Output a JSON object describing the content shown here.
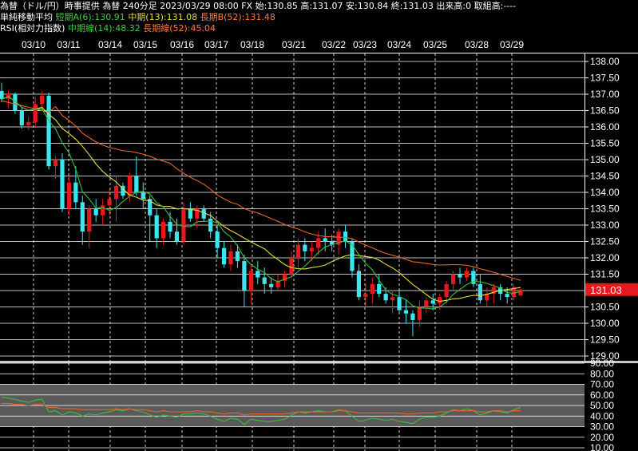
{
  "header": {
    "line1": "為替（ドル/円）時事提供 為替 240分足 2023/03/29 08:00 FX 始:130.85 高:131.07 安:130.84 終:131.03 出来高:0 取組高:----",
    "ma_title": "単純移動平均",
    "ma_short": "短期A(6):130.91",
    "ma_mid": "中期(13):131.08",
    "ma_long": "長期B(52):131.48",
    "rsi_title": "RSI(相対力指数)",
    "rsi_mid": "中期線(14):48.32",
    "rsi_long": "長期線(52):45.04"
  },
  "colors": {
    "up": "#e8191e",
    "down": "#3ce6f0",
    "ma_short": "#3cbe3c",
    "ma_mid": "#e6dc3c",
    "ma_long": "#e8642d",
    "rsi_mid": "#3cbe3c",
    "rsi_long": "#e8642d",
    "price_box": "#e8191e"
  },
  "chart_data": [
    {
      "type": "candlestick",
      "dates": [
        "03/10",
        "03/11",
        "03/14",
        "03/15",
        "03/16",
        "03/17",
        "03/18",
        "03/21",
        "03/22",
        "03/23",
        "03/24",
        "03/25",
        "03/28",
        "03/29"
      ],
      "ylim": [
        129.0,
        138.0
      ],
      "yticks": [
        "138.00",
        "137.50",
        "137.00",
        "136.50",
        "136.00",
        "135.50",
        "135.00",
        "134.50",
        "134.00",
        "133.50",
        "133.00",
        "132.50",
        "132.00",
        "131.50",
        "131.00",
        "130.50",
        "130.00",
        "129.50",
        "129.00"
      ],
      "last_price": "131.03",
      "ohlc": [
        [
          137.1,
          137.35,
          136.75,
          136.85
        ],
        [
          136.85,
          137.1,
          136.55,
          137.0
        ],
        [
          137.0,
          137.05,
          136.4,
          136.5
        ],
        [
          136.5,
          136.6,
          135.95,
          136.05
        ],
        [
          136.05,
          136.3,
          135.9,
          136.15
        ],
        [
          136.15,
          136.9,
          136.0,
          136.7
        ],
        [
          136.7,
          137.1,
          136.5,
          136.95
        ],
        [
          136.95,
          137.05,
          134.7,
          134.8
        ],
        [
          134.8,
          135.1,
          134.4,
          135.0
        ],
        [
          135.0,
          135.2,
          133.4,
          133.5
        ],
        [
          133.5,
          134.5,
          133.3,
          134.3
        ],
        [
          134.3,
          134.8,
          133.5,
          133.7
        ],
        [
          133.7,
          133.9,
          132.4,
          132.8
        ],
        [
          132.8,
          133.6,
          132.3,
          133.5
        ],
        [
          133.5,
          133.8,
          133.1,
          133.3
        ],
        [
          133.3,
          133.8,
          133.0,
          133.6
        ],
        [
          133.6,
          134.1,
          133.3,
          133.8
        ],
        [
          133.8,
          134.5,
          133.1,
          134.2
        ],
        [
          134.2,
          134.3,
          133.8,
          133.9
        ],
        [
          133.9,
          134.6,
          133.7,
          134.5
        ],
        [
          134.5,
          135.1,
          133.9,
          134.0
        ],
        [
          134.0,
          134.3,
          133.5,
          133.8
        ],
        [
          133.8,
          133.9,
          132.5,
          133.3
        ],
        [
          133.3,
          133.5,
          132.3,
          132.6
        ],
        [
          132.6,
          133.2,
          132.4,
          133.1
        ],
        [
          133.1,
          133.4,
          132.6,
          132.8
        ],
        [
          132.8,
          133.2,
          132.4,
          132.5
        ],
        [
          132.5,
          133.7,
          132.4,
          133.5
        ],
        [
          133.5,
          133.7,
          133.1,
          133.2
        ],
        [
          133.2,
          133.6,
          132.9,
          133.5
        ],
        [
          133.5,
          133.6,
          133.1,
          133.2
        ],
        [
          133.2,
          133.4,
          132.6,
          132.8
        ],
        [
          132.8,
          133.0,
          132.0,
          132.3
        ],
        [
          132.3,
          132.5,
          131.7,
          131.8
        ],
        [
          131.8,
          132.4,
          131.6,
          132.2
        ],
        [
          132.2,
          132.4,
          131.7,
          131.9
        ],
        [
          131.9,
          132.1,
          130.5,
          131.0
        ],
        [
          131.0,
          131.8,
          130.6,
          131.6
        ],
        [
          131.6,
          131.9,
          131.2,
          131.4
        ],
        [
          131.4,
          131.7,
          130.9,
          131.2
        ],
        [
          131.2,
          131.4,
          130.9,
          131.1
        ],
        [
          131.1,
          131.5,
          131.0,
          131.3
        ],
        [
          131.3,
          131.6,
          131.1,
          131.5
        ],
        [
          131.5,
          132.2,
          131.4,
          132.0
        ],
        [
          132.0,
          132.6,
          131.7,
          132.4
        ],
        [
          132.4,
          132.6,
          131.9,
          132.2
        ],
        [
          132.2,
          132.5,
          131.9,
          132.3
        ],
        [
          132.3,
          132.8,
          132.1,
          132.6
        ],
        [
          132.6,
          132.9,
          132.2,
          132.5
        ],
        [
          132.5,
          132.7,
          132.2,
          132.4
        ],
        [
          132.4,
          132.9,
          132.1,
          132.8
        ],
        [
          132.8,
          133.0,
          132.3,
          132.5
        ],
        [
          132.5,
          132.6,
          131.4,
          131.6
        ],
        [
          131.6,
          131.8,
          130.7,
          130.8
        ],
        [
          130.8,
          131.2,
          130.5,
          130.9
        ],
        [
          130.9,
          131.4,
          130.6,
          131.2
        ],
        [
          131.2,
          131.5,
          130.8,
          130.9
        ],
        [
          130.9,
          131.1,
          130.6,
          130.7
        ],
        [
          130.7,
          131.0,
          130.3,
          130.8
        ],
        [
          130.8,
          131.0,
          130.3,
          130.4
        ],
        [
          130.4,
          130.7,
          130.0,
          130.3
        ],
        [
          130.3,
          130.4,
          129.6,
          130.1
        ],
        [
          130.1,
          130.7,
          129.9,
          130.5
        ],
        [
          130.5,
          130.8,
          130.3,
          130.7
        ],
        [
          130.7,
          130.9,
          130.4,
          130.6
        ],
        [
          130.6,
          130.9,
          130.4,
          130.8
        ],
        [
          130.8,
          131.3,
          130.6,
          131.2
        ],
        [
          131.2,
          131.6,
          131.0,
          131.5
        ],
        [
          131.5,
          131.7,
          131.2,
          131.4
        ],
        [
          131.4,
          131.7,
          131.3,
          131.6
        ],
        [
          131.6,
          131.7,
          131.1,
          131.2
        ],
        [
          131.2,
          131.5,
          130.6,
          130.7
        ],
        [
          130.7,
          131.1,
          130.5,
          130.9
        ],
        [
          130.9,
          131.2,
          130.6,
          131.1
        ],
        [
          131.1,
          131.2,
          130.7,
          130.9
        ],
        [
          130.9,
          131.1,
          130.6,
          130.8
        ],
        [
          130.8,
          131.2,
          130.7,
          131.1
        ],
        [
          130.85,
          131.07,
          130.84,
          131.03
        ]
      ]
    },
    {
      "type": "line",
      "ylim": [
        10,
        90
      ],
      "yticks": [
        "90.00",
        "80.00",
        "70.00",
        "60.00",
        "50.00",
        "40.00",
        "30.00",
        "20.00",
        "10.00"
      ],
      "series": [
        {
          "name": "中期線(14)",
          "values": [
            58,
            57,
            56,
            54,
            53,
            55,
            56,
            44,
            45,
            41,
            44,
            43,
            40,
            42,
            41,
            43,
            44,
            46,
            45,
            47,
            45,
            44,
            41,
            39,
            41,
            40,
            39,
            42,
            42,
            43,
            42,
            40,
            37,
            35,
            38,
            37,
            32,
            37,
            36,
            35,
            35,
            36,
            37,
            41,
            44,
            43,
            44,
            45,
            44,
            44,
            46,
            45,
            40,
            35,
            36,
            38,
            37,
            36,
            37,
            35,
            34,
            33,
            37,
            39,
            39,
            40,
            43,
            46,
            45,
            47,
            45,
            41,
            43,
            45,
            44,
            43,
            46,
            48.32
          ]
        },
        {
          "name": "長期線(52)",
          "values": [
            52,
            52,
            51,
            51,
            50,
            51,
            51,
            48,
            48,
            47,
            47,
            47,
            46,
            46,
            46,
            46,
            46,
            47,
            46,
            47,
            46,
            46,
            45,
            44,
            45,
            44,
            44,
            44,
            44,
            45,
            44,
            44,
            43,
            42,
            43,
            43,
            41,
            42,
            42,
            42,
            42,
            42,
            42,
            43,
            44,
            44,
            44,
            44,
            44,
            44,
            45,
            45,
            44,
            43,
            43,
            43,
            43,
            43,
            43,
            43,
            42,
            42,
            43,
            43,
            43,
            44,
            44,
            45,
            45,
            45,
            45,
            44,
            44,
            45,
            45,
            44,
            45,
            45.04
          ]
        }
      ]
    }
  ]
}
